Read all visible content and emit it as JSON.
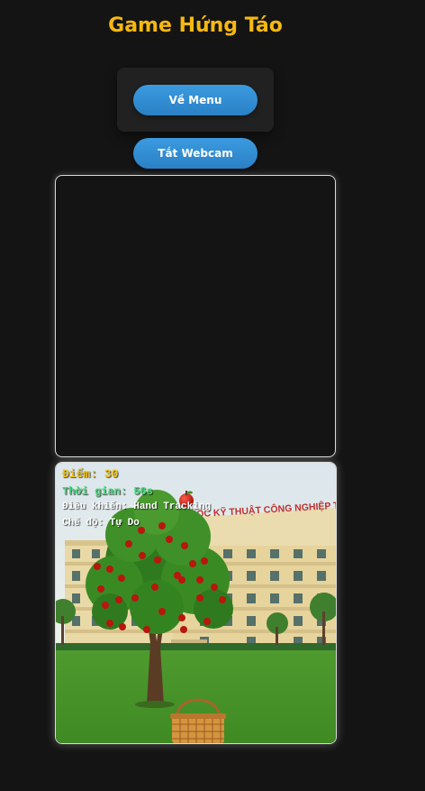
{
  "title": "Game Hứng Táo",
  "buttons": {
    "menu": "Về Menu",
    "webcam": "Tắt Webcam"
  },
  "hud": {
    "score": "Điểm: 30",
    "time": "Thời gian: 56s",
    "control": "Điều khiển: Hand Tracking",
    "mode": "Chế độ: Tự Do"
  },
  "scene": {
    "building_sign": "ĐẠI HỌC KỸ THUẬT CÔNG NGHIỆP T.N.UT"
  },
  "colors": {
    "background": "#141414",
    "title": "#f6b810",
    "button": "#2f8bd2",
    "score": "#f0c419",
    "time": "#44e07a"
  }
}
